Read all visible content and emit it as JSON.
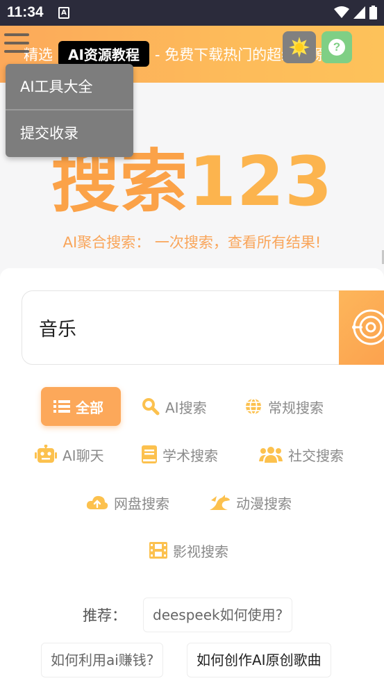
{
  "status_bar": {
    "time": "11:34",
    "notification_icon": "A"
  },
  "banner": {
    "prefix": "精选",
    "tag": "AI资源教程",
    "suffix": "- 免费下载热门的超级资源!",
    "menu_icon": "hamburger-icon",
    "theme_icon": "sun-icon",
    "help_icon": "question-icon",
    "help_glyph": "?"
  },
  "menu": {
    "items": [
      {
        "label": "AI工具大全"
      },
      {
        "label": "提交收录"
      }
    ]
  },
  "hero": {
    "title_part1": "搜索",
    "title_part2": "123",
    "subtitle": "AI聚合搜索： 一次搜索，查看所有结果!"
  },
  "search": {
    "value": "音乐",
    "placeholder": ""
  },
  "categories": [
    {
      "label": "全部",
      "icon": "list-icon",
      "active": true
    },
    {
      "label": "AI搜索",
      "icon": "search-icon"
    },
    {
      "label": "常规搜索",
      "icon": "globe-icon"
    },
    {
      "label": "AI聊天",
      "icon": "robot-icon"
    },
    {
      "label": "学术搜索",
      "icon": "book-icon"
    },
    {
      "label": "社交搜索",
      "icon": "users-icon"
    },
    {
      "label": "网盘搜索",
      "icon": "cloud-upload-icon"
    },
    {
      "label": "动漫搜索",
      "icon": "dragon-icon"
    },
    {
      "label": "影视搜索",
      "icon": "film-icon"
    }
  ],
  "recommend": {
    "label": "推荐：",
    "items": [
      "deespeek如何使用?",
      "如何利用ai赚钱?",
      "如何创作AI原创歌曲"
    ]
  },
  "colors": {
    "accent": "#fca85a",
    "icon": "#fcc14e",
    "banner": "#fdb65a",
    "help": "#7fcf85"
  }
}
